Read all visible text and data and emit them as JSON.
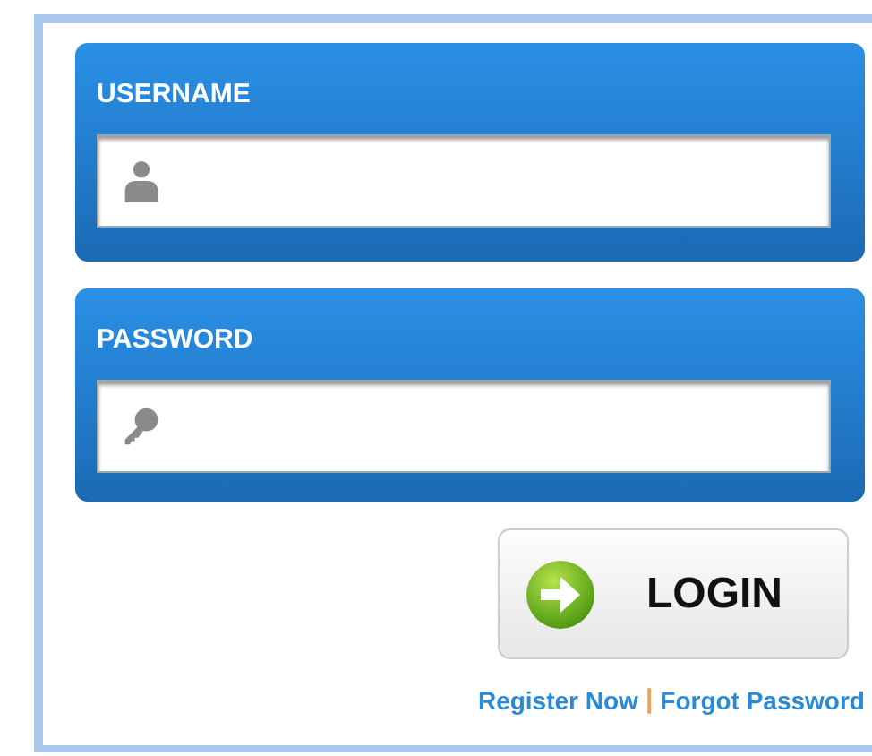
{
  "fields": [
    {
      "kind": "user",
      "label": "USERNAME"
    },
    {
      "kind": "key",
      "label": "PASSWORD"
    }
  ],
  "login_button": {
    "label": "LOGIN"
  },
  "links": [
    {
      "kind": "link",
      "text": "Register Now"
    },
    {
      "kind": "separator",
      "text": "|"
    },
    {
      "kind": "link",
      "text": "Forgot Password"
    }
  ]
}
